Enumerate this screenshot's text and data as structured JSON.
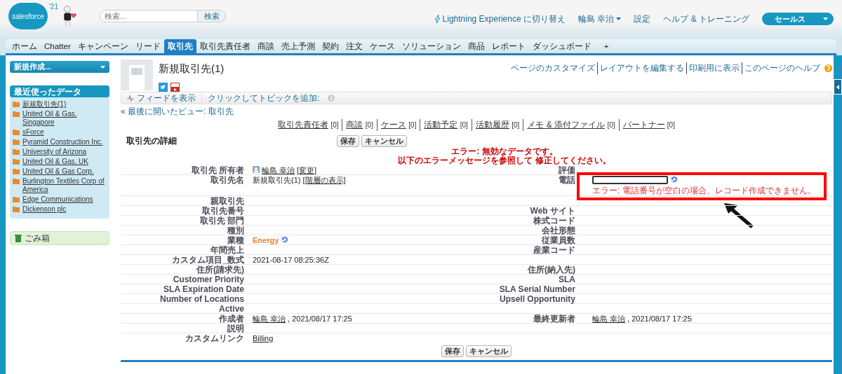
{
  "header": {
    "logo": {
      "text": "salesforce",
      "badge": "'21"
    },
    "search": {
      "placeholder": "検索...",
      "button": "検索"
    },
    "links": [
      {
        "kind": "lightning",
        "text": "Lightning Experience に切り替え"
      },
      {
        "kind": "menu",
        "text": "輪島 幸治"
      },
      {
        "kind": "plain",
        "text": "設定"
      },
      {
        "kind": "plain",
        "text": "ヘルプ & トレーニング"
      }
    ],
    "app_menu": "セールス"
  },
  "tabs": [
    {
      "label": "ホーム",
      "selected": false
    },
    {
      "label": "Chatter",
      "selected": false
    },
    {
      "label": "キャンペーン",
      "selected": false
    },
    {
      "label": "リード",
      "selected": false
    },
    {
      "label": "取引先",
      "selected": true
    },
    {
      "label": "取引先責任者",
      "selected": false
    },
    {
      "label": "商談",
      "selected": false
    },
    {
      "label": "売上予測",
      "selected": false
    },
    {
      "label": "契約",
      "selected": false
    },
    {
      "label": "注文",
      "selected": false
    },
    {
      "label": "ケース",
      "selected": false
    },
    {
      "label": "ソリューション",
      "selected": false
    },
    {
      "label": "商品",
      "selected": false
    },
    {
      "label": "レポート",
      "selected": false
    },
    {
      "label": "ダッシュボード",
      "selected": false
    }
  ],
  "tab_add": "+",
  "sidebar": {
    "create_menu": "新規作成...",
    "recent": {
      "title": "最近使ったデータ",
      "items": [
        "新規取引先(1)",
        "United Oil & Gas, Singapore",
        "sForce",
        "Pyramid Construction Inc.",
        "University of Arizona",
        "United Oil & Gas, UK",
        "United Oil & Gas Corp.",
        "Burlington Textiles Corp of America",
        "Edge Communications",
        "Dickenson plc"
      ]
    },
    "recycle_bin": "ごみ箱"
  },
  "page": {
    "title": "新規取引先(1)",
    "links": [
      "ページのカスタマイズ",
      "レイアウトを編集する",
      "印刷用に表示",
      "このページのヘルプ"
    ],
    "feed": {
      "show_feed": "フィードを表示",
      "topics": "クリックしてトピックを追加:"
    },
    "breadcrumb": {
      "mark": "«",
      "text": "最後に開いたビュー: 取引先"
    },
    "related_links": [
      {
        "label": "取引先責任者",
        "count": "[0]"
      },
      {
        "label": "商談",
        "count": "[0]"
      },
      {
        "label": "ケース",
        "count": "[0]"
      },
      {
        "label": "活動予定",
        "count": "[0]"
      },
      {
        "label": "活動履歴",
        "count": "[0]"
      },
      {
        "label": "メモ & 添付ファイル",
        "count": "[0]"
      },
      {
        "label": "パートナー",
        "count": "[0]"
      }
    ]
  },
  "detail": {
    "title": "取引先の詳細",
    "buttons": [
      "保存",
      "キャンセル"
    ],
    "errors": [
      "エラー: 無効なデータです。",
      "以下のエラーメッセージを参照して 修正してください。"
    ],
    "rows": [
      {
        "left": {
          "label": "取引先 所有者",
          "kind": "owner",
          "value": [
            {
              "kind": "link",
              "text": "輪島 幸治"
            },
            {
              "kind": "link",
              "text": "[変更]"
            }
          ]
        },
        "right": {
          "label": "評価",
          "kind": "text"
        }
      },
      {
        "left": {
          "label": "取引先名",
          "kind": "text",
          "value": [
            {
              "kind": "text",
              "text": "新規取引先(1)"
            },
            {
              "kind": "link",
              "text": "[階層の表示]"
            }
          ]
        },
        "right": {
          "label": "電話",
          "kind": "input",
          "error": "エラー: 電話番号が空白の場合、レコード作成できません。"
        }
      },
      {
        "left": {
          "label": "親取引先",
          "kind": "text"
        }
      },
      {
        "left": {
          "label": "取引先番号",
          "kind": "text"
        },
        "right": {
          "label": "Web サイト",
          "kind": "text"
        }
      },
      {
        "left": {
          "label": "取引先 部門",
          "kind": "text"
        },
        "right": {
          "label": "株式コード",
          "kind": "text"
        }
      },
      {
        "left": {
          "label": "種別",
          "kind": "text"
        },
        "right": {
          "label": "会社形態",
          "kind": "text"
        }
      },
      {
        "left": {
          "label": "業種",
          "kind": "picklist",
          "value": [
            {
              "kind": "highlight",
              "text": "Energy"
            }
          ]
        },
        "right": {
          "label": "従業員数",
          "kind": "text"
        }
      },
      {
        "left": {
          "label": "年間売上",
          "kind": "text"
        },
        "right": {
          "label": "産業コード",
          "kind": "text"
        }
      },
      {
        "left": {
          "label": "カスタム項目_数式",
          "kind": "text",
          "value": [
            {
              "kind": "text",
              "text": "2021-08-17 08:25:36Z"
            }
          ]
        }
      },
      {
        "left": {
          "label": "住所(請求先)",
          "kind": "text"
        },
        "right": {
          "label": "住所(納入先)",
          "kind": "text"
        }
      },
      {
        "left": {
          "label": "Customer Priority",
          "kind": "text"
        },
        "right": {
          "label": "SLA",
          "kind": "text"
        }
      },
      {
        "left": {
          "label": "SLA Expiration Date",
          "kind": "text"
        },
        "right": {
          "label": "SLA Serial Number",
          "kind": "text"
        }
      },
      {
        "left": {
          "label": "Number of Locations",
          "kind": "text"
        },
        "right": {
          "label": "Upsell Opportunity",
          "kind": "text"
        }
      },
      {
        "left": {
          "label": "Active",
          "kind": "text"
        }
      },
      {
        "left": {
          "label": "作成者",
          "kind": "text",
          "value": [
            {
              "kind": "link",
              "text": "輪島 幸治"
            },
            {
              "kind": "text",
              "text": ", 2021/08/17 17:25"
            }
          ]
        },
        "right": {
          "label": "最終更新者",
          "kind": "text",
          "value": [
            {
              "kind": "link",
              "text": "輪島 幸治"
            },
            {
              "kind": "text",
              "text": ", 2021/08/17 17:25"
            }
          ]
        }
      },
      {
        "left": {
          "label": "説明",
          "kind": "text"
        }
      },
      {
        "left": {
          "label": "カスタムリンク",
          "kind": "text",
          "value": [
            {
              "kind": "link",
              "text": "Billing"
            }
          ]
        }
      }
    ],
    "bottom_buttons": [
      "保存",
      "キャンセル"
    ]
  }
}
